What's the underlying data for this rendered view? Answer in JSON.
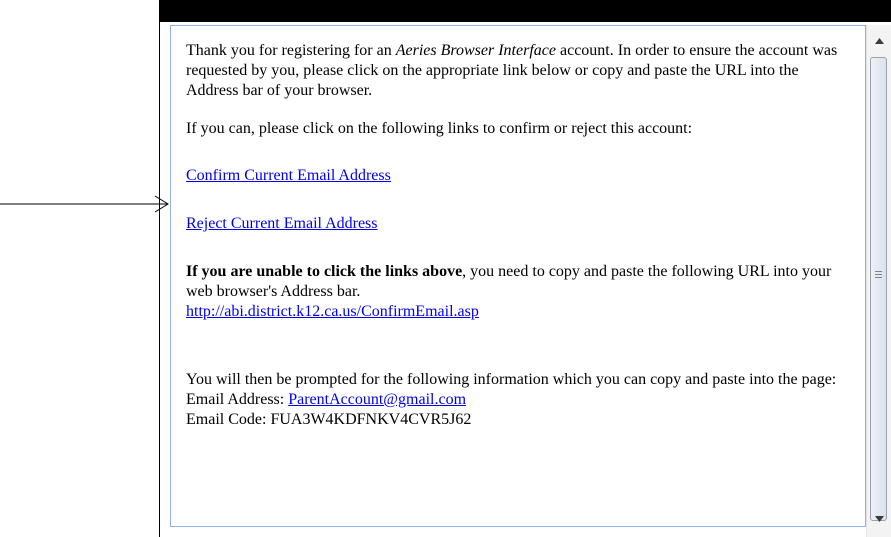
{
  "email": {
    "intro_pre": "Thank you for registering for an ",
    "intro_product": "Aeries Browser Interface",
    "intro_post": " account. In order to ensure the account was requested by you, please click on the appropriate link below or copy and paste the URL into the Address bar of your browser.",
    "links_intro": "If you can, please click on the following links to confirm or reject this account:",
    "confirm_link": "Confirm Current Email Address",
    "reject_link": "Reject Current Email Address",
    "unable_bold": "If you are unable to click the links above",
    "unable_rest": ", you need to copy and paste the following URL into your web browser's Address bar.",
    "confirm_url": "http://abi.district.k12.ca.us/ConfirmEmail.asp",
    "prompt_text": "You will then be prompted for the following information which you can copy and paste into the page:",
    "email_address_label": "Email Address: ",
    "email_address_value": "ParentAccount@gmail.com",
    "email_code_label": "Email Code: ",
    "email_code_value": "FUA3W4KDFNKV4CVR5J62"
  },
  "icons": {
    "pointer": "arrow-right-icon",
    "scroll_up": "scroll-up-arrow-icon",
    "scroll_down": "scroll-down-arrow-icon"
  },
  "colors": {
    "link": "#0000ee",
    "panel_border": "#8db2e3",
    "top_bar": "#000000"
  }
}
